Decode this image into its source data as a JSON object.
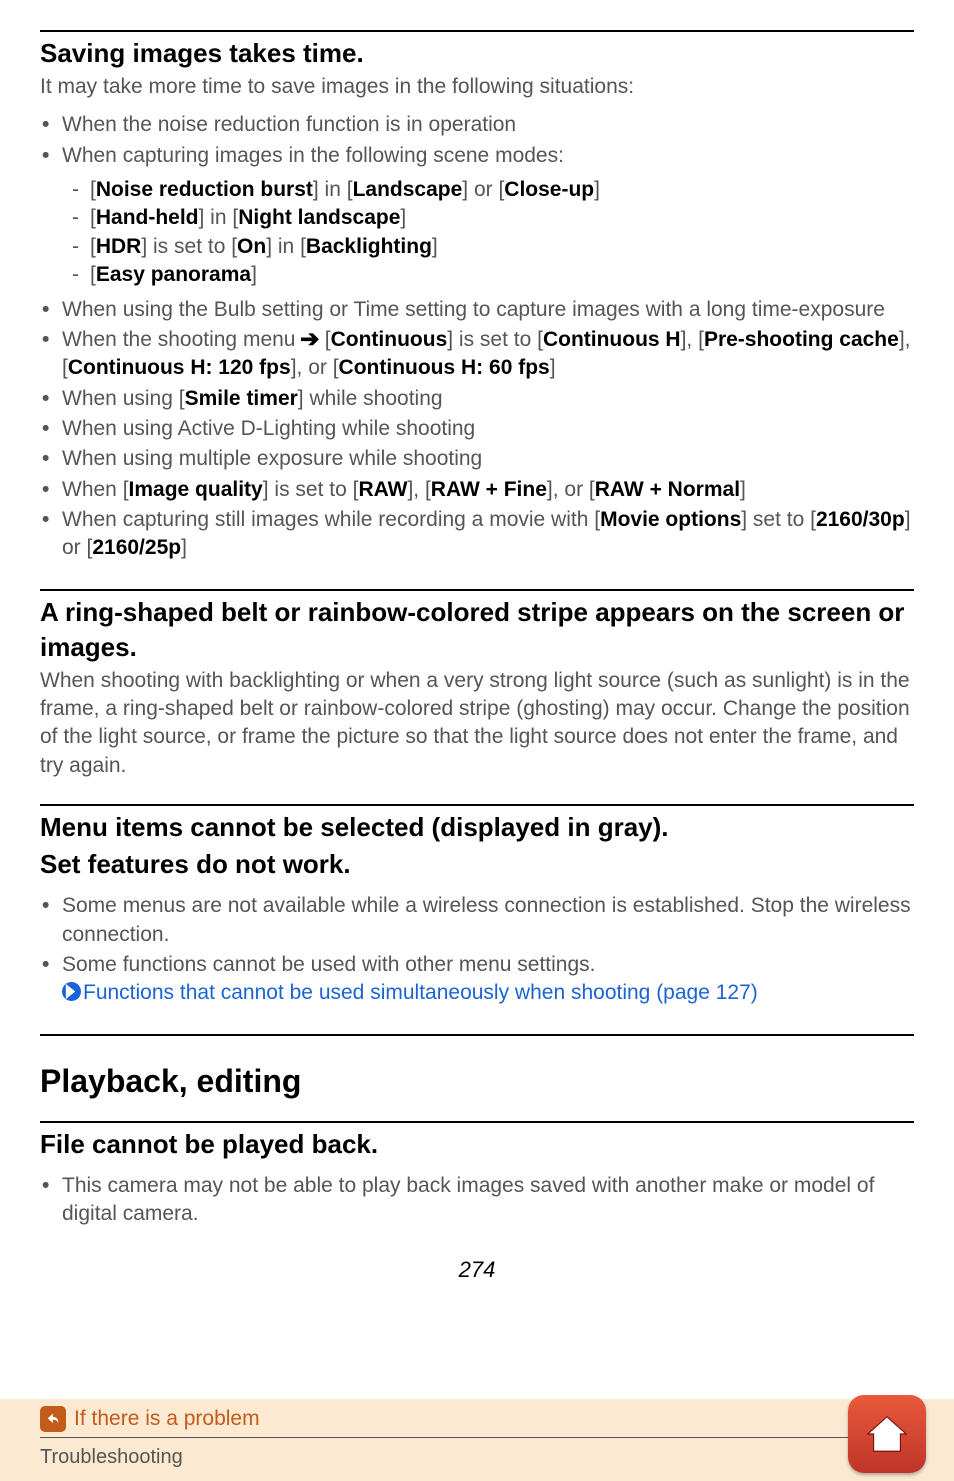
{
  "sec1": {
    "title": "Saving images takes time.",
    "intro": "It may take more time to save images in the following situations:",
    "b1": "When the noise reduction function is in operation",
    "b2": "When capturing images in the following scene modes:",
    "d1_pre": "[",
    "d1_a": "Noise reduction burst",
    "d1_mid1": "] in [",
    "d1_b": "Landscape",
    "d1_mid2": "] or [",
    "d1_c": "Close-up",
    "d1_post": "]",
    "d2_pre": "[",
    "d2_a": "Hand-held",
    "d2_mid": "] in [",
    "d2_b": "Night landscape",
    "d2_post": "]",
    "d3_pre": "[",
    "d3_a": "HDR",
    "d3_mid1": "] is set to [",
    "d3_b": "On",
    "d3_mid2": "] in [",
    "d3_c": "Backlighting",
    "d3_post": "]",
    "d4_pre": "[",
    "d4_a": "Easy panorama",
    "d4_post": "]",
    "b3": "When using the Bulb setting or Time setting to capture images with a long time-exposure",
    "b4_a": "When the shooting menu ",
    "b4_arrow": "➔",
    "b4_b": " [",
    "b4_c": "Continuous",
    "b4_d": "] is set to [",
    "b4_e": "Continuous H",
    "b4_f": "], [",
    "b4_g": "Pre-shooting cache",
    "b4_h": "], [",
    "b4_i": "Continuous H: 120 fps",
    "b4_j": "], or [",
    "b4_k": "Continuous H: 60 fps",
    "b4_l": "]",
    "b5_a": "When using [",
    "b5_b": "Smile timer",
    "b5_c": "] while shooting",
    "b6": "When using Active D-Lighting while shooting",
    "b7": "When using multiple exposure while shooting",
    "b8_a": "When [",
    "b8_b": "Image quality",
    "b8_c": "] is set to [",
    "b8_d": "RAW",
    "b8_e": "], [",
    "b8_f": "RAW + Fine",
    "b8_g": "], or [",
    "b8_h": "RAW + Normal",
    "b8_i": "]",
    "b9_a": "When capturing still images while recording a movie with [",
    "b9_b": "Movie options",
    "b9_c": "] set to [",
    "b9_d": "2160/30p",
    "b9_e": "] or [",
    "b9_f": "2160/25p",
    "b9_g": "]"
  },
  "sec2": {
    "title": "A ring-shaped belt or rainbow-colored stripe appears on the screen or images.",
    "body": "When shooting with backlighting or when a very strong light source (such as sunlight) is in the frame, a ring-shaped belt or rainbow-colored stripe (ghosting) may occur. Change the position of the light source, or frame the picture so that the light source does not enter the frame, and try again."
  },
  "sec3": {
    "title1": "Menu items cannot be selected (displayed in gray).",
    "title2": "Set features do not work.",
    "b1": "Some menus are not available while a wireless connection is established. Stop the wireless connection.",
    "b2": "Some functions cannot be used with other menu settings.",
    "link": "Functions that cannot be used simultaneously when shooting (page 127)"
  },
  "major": "Playback, editing",
  "sec4": {
    "title": "File cannot be played back.",
    "b1": "This camera may not be able to play back images saved with another make or model of digital camera."
  },
  "pagenum": "274",
  "footer": {
    "link": "If there is a problem",
    "crumb": "Troubleshooting"
  }
}
